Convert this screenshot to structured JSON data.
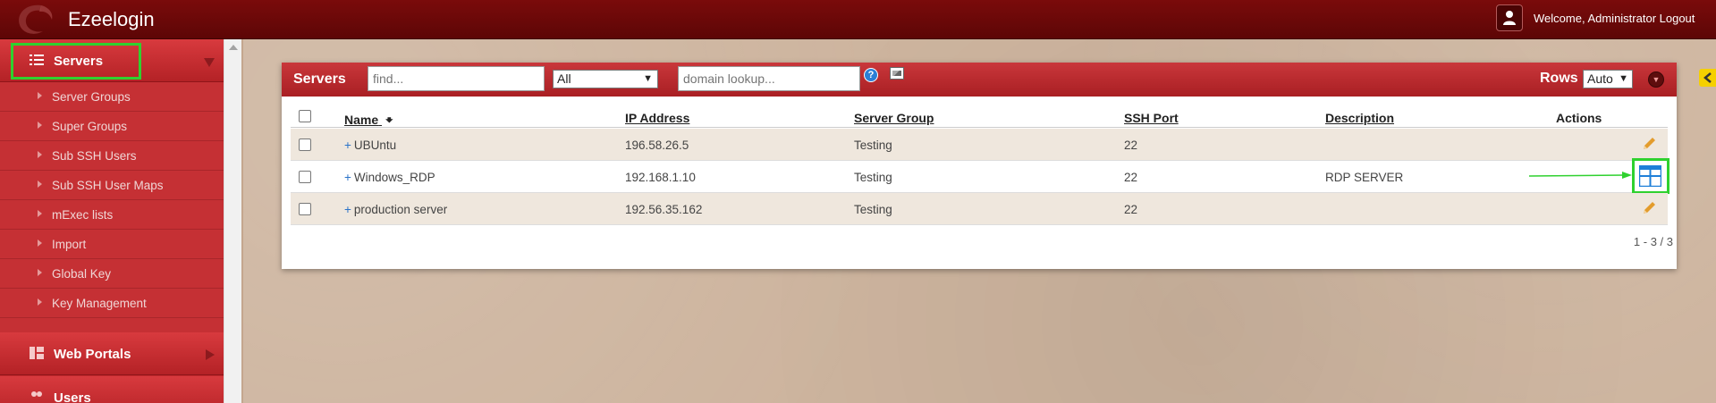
{
  "app": {
    "title": "Ezeelogin",
    "welcome": "Welcome, Administrator Logout"
  },
  "sidebar": {
    "main": {
      "label": "Servers",
      "icon": "list-icon"
    },
    "submenu": [
      "Server Groups",
      "Super Groups",
      "Sub SSH Users",
      "Sub SSH User Maps",
      "mExec lists",
      "Import",
      "Global Key",
      "Key Management"
    ],
    "web_portals": "Web Portals",
    "users": "Users"
  },
  "panel": {
    "title": "Servers",
    "find_placeholder": "find...",
    "filter_value": "All",
    "domain_placeholder": "domain lookup...",
    "rows_label": "Rows",
    "rows_value": "Auto",
    "help_glyph": "?"
  },
  "table": {
    "columns": {
      "name": "Name",
      "ip": "IP Address",
      "group": "Server Group",
      "port": "SSH Port",
      "description": "Description",
      "actions": "Actions"
    },
    "rows": [
      {
        "name": "UBUntu",
        "ip": "196.58.26.5",
        "group": "Testing",
        "port": "22",
        "description": "",
        "action_icon": "pencil-icon"
      },
      {
        "name": "Windows_RDP",
        "ip": "192.168.1.10",
        "group": "Testing",
        "port": "22",
        "description": "RDP SERVER",
        "action_icon": "windows-rdp-icon"
      },
      {
        "name": "production server",
        "ip": "192.56.35.162",
        "group": "Testing",
        "port": "22",
        "description": "",
        "action_icon": "pencil-icon"
      }
    ],
    "pagination": "1 - 3 / 3"
  },
  "colors": {
    "header": "#6b0909",
    "sidebar": "#c0282c",
    "highlight": "#2fd12f",
    "accent_blue": "#2a73c8"
  }
}
